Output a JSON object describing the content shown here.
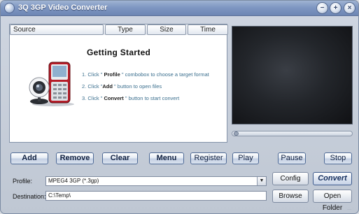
{
  "window": {
    "title": "3Q 3GP Video Converter"
  },
  "title_buttons": {
    "minimize": "−",
    "maximize": "+",
    "close": "×"
  },
  "file_list": {
    "columns": [
      "Source",
      "Type",
      "Size",
      "Time"
    ],
    "getting_started": {
      "title": "Getting  Started",
      "steps": [
        {
          "num": "1.",
          "pre": "Click \" ",
          "key": "Profile",
          "post": " \" combobox to choose a target format"
        },
        {
          "num": "2.",
          "pre": "Click \"",
          "key": "Add",
          "post": " \" button to open files"
        },
        {
          "num": "3.",
          "pre": "Click \" ",
          "key": "Convert",
          "post": " \" button to start convert"
        }
      ]
    }
  },
  "player": {
    "progress": 0
  },
  "toolbar": {
    "add": "Add",
    "remove": "Remove",
    "clear": "Clear",
    "menu": "Menu",
    "register": "Register",
    "play": "Play",
    "pause": "Pause",
    "stop": "Stop"
  },
  "settings": {
    "profile_label": "Profile:",
    "profile_value": "MPEG4 3GP (*.3gp)",
    "destination_label": "Destination:",
    "destination_value": "C:\\Temp\\",
    "config": "Config",
    "convert": "Convert",
    "browse": "Browse",
    "open_folder": "Open Folder"
  },
  "icons": {
    "app": "app-orb-icon",
    "illustration": "phone-webcam-illustration",
    "dropdown": "chevron-down-icon"
  },
  "colors": {
    "titlebar": "#7f97c2",
    "preview_bg": "#23262b",
    "step_text": "#3b6f8e"
  }
}
